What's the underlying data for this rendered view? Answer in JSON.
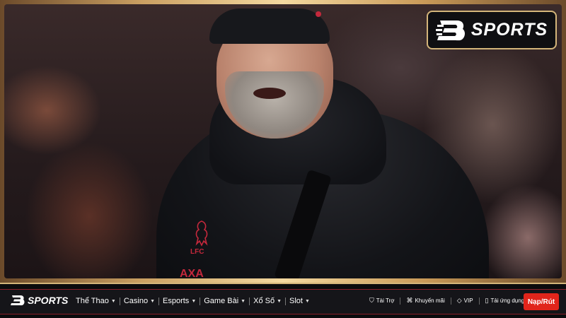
{
  "brand": {
    "name": "SPORTS",
    "logo_icon": "b-sports-logo-icon",
    "accent": "#d4b57a",
    "cta_color": "#e1251b"
  },
  "hero": {
    "image_subject": "coach-photo",
    "crest_text": "LFC",
    "sponsor_text": "AXA"
  },
  "nav": {
    "items": [
      {
        "label": "Thể Thao"
      },
      {
        "label": "Casino"
      },
      {
        "label": "Esports"
      },
      {
        "label": "Game Bài"
      },
      {
        "label": "Xổ Số"
      },
      {
        "label": "Slot"
      }
    ],
    "utilities": [
      {
        "label": "Tài Trợ",
        "icon": "sponsor-icon"
      },
      {
        "label": "Khuyến mãi",
        "icon": "promo-icon"
      },
      {
        "label": "VIP",
        "icon": "diamond-icon"
      },
      {
        "label": "Tải ứng dụng",
        "icon": "mobile-icon"
      }
    ],
    "cta_label": "Nạp/Rút"
  }
}
